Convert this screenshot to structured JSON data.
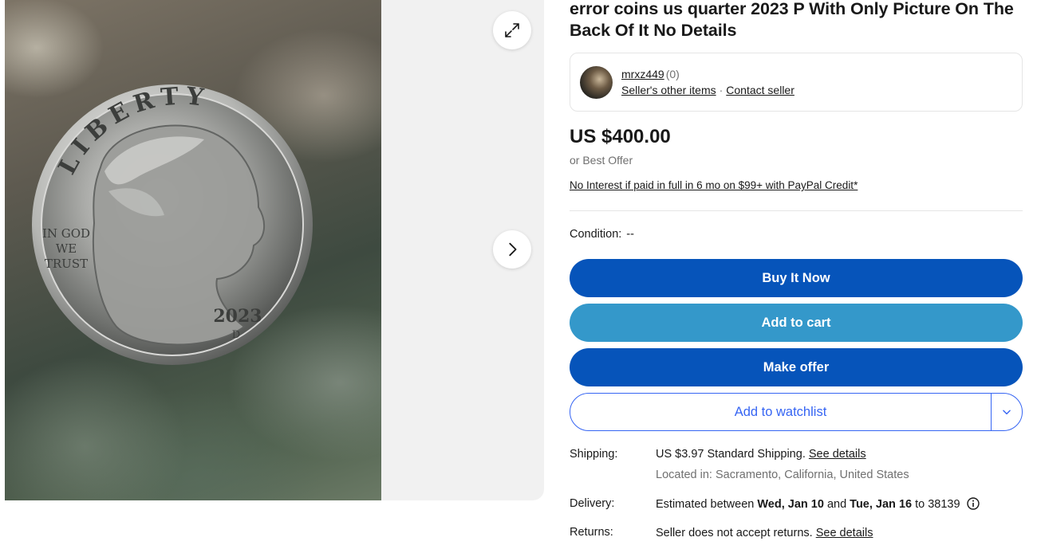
{
  "gallery": {
    "photo_alt": "",
    "coin_text": {
      "top": "LIBERTY",
      "motto_line1": "IN GOD",
      "motto_line2": "WE",
      "motto_line3": "TRUST",
      "year": "2023",
      "mint": "D"
    },
    "icons": {
      "expand": "expand-icon",
      "next": "chevron-right-icon"
    }
  },
  "listing": {
    "title": "error coins us quarter 2023 P With Only Picture On The Back Of It No Details"
  },
  "seller": {
    "name": "mrxz449",
    "score": "(0)",
    "other_items": "Seller's other items",
    "separator": "·",
    "contact": "Contact seller"
  },
  "pricing": {
    "price": "US $400.00",
    "best_offer": "or Best Offer",
    "credit": "No Interest if paid in full in 6 mo on $99+ with PayPal Credit*"
  },
  "condition": {
    "label": "Condition:",
    "value": "--"
  },
  "actions": {
    "buy": "Buy It Now",
    "cart": "Add to cart",
    "offer": "Make offer",
    "watch": "Add to watchlist"
  },
  "shipping": {
    "label": "Shipping:",
    "cost": "US $3.97",
    "method": "Standard Shipping.",
    "details": "See details",
    "location_label": "Located in:",
    "location": "Sacramento, California, United States"
  },
  "delivery": {
    "label": "Delivery:",
    "prefix": "Estimated between",
    "start": "Wed, Jan 10",
    "and": "and",
    "end": "Tue, Jan 16",
    "to": "to 38139"
  },
  "returns": {
    "label": "Returns:",
    "text": "Seller does not accept returns.",
    "details": "See details"
  },
  "colors": {
    "primary_blue": "#0654ba",
    "secondary_blue": "#3498ca",
    "link_blue": "#3665f3"
  }
}
